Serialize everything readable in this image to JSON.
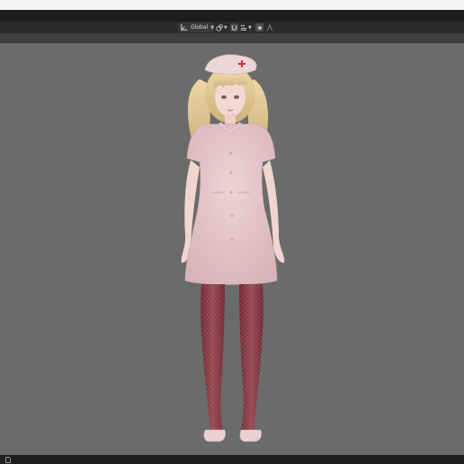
{
  "header": {
    "transform_orientation": "Global"
  },
  "icons": {
    "orientation": "orientation-axes-icon",
    "pivot": "pivot-point-icon",
    "snap": "snap-magnet-icon",
    "increment": "snap-increment-icon",
    "proportional": "proportional-editing-icon",
    "falloff": "falloff-curve-icon",
    "status": "file-icon"
  },
  "colors": {
    "viewport_background": "#6b6b6b",
    "header_background": "#2b2b2b",
    "dress": "#e6c9cd",
    "stockings": "#8a3a45",
    "hair": "#e2cb97"
  }
}
